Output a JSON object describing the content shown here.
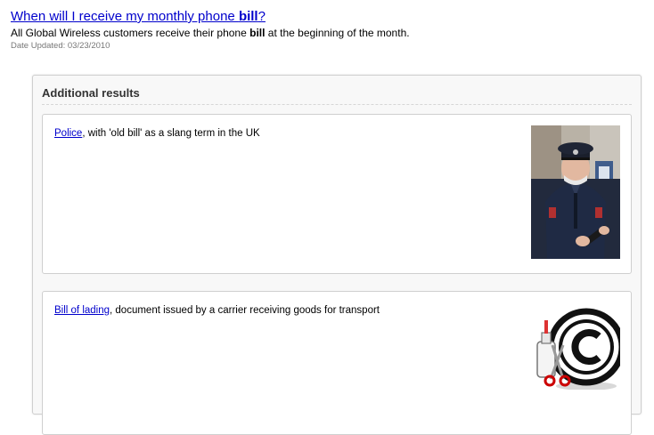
{
  "top_result": {
    "title_prefix": "When will I receive my monthly phone ",
    "title_bold": "bill",
    "title_suffix": "?",
    "snippet_prefix": "All Global Wireless customers receive their phone ",
    "snippet_bold": "bill",
    "snippet_suffix": " at the beginning of the month.",
    "date_text": "Date Updated: 03/23/2010"
  },
  "additional": {
    "heading": "Additional results",
    "items": [
      {
        "link": "Police",
        "description": ", with 'old bill' as a slang term in the UK",
        "image_icon": "police-officer-photo"
      },
      {
        "link": "Bill of lading",
        "description": ", document issued by a carrier receiving goods for transport",
        "image_icon": "copyright-symbol-with-scissors-and-glue"
      }
    ]
  },
  "colors": {
    "link": "#0000cc",
    "date": "#777777",
    "panel_bg": "#f8f8f8",
    "border": "#cfcfcf"
  }
}
